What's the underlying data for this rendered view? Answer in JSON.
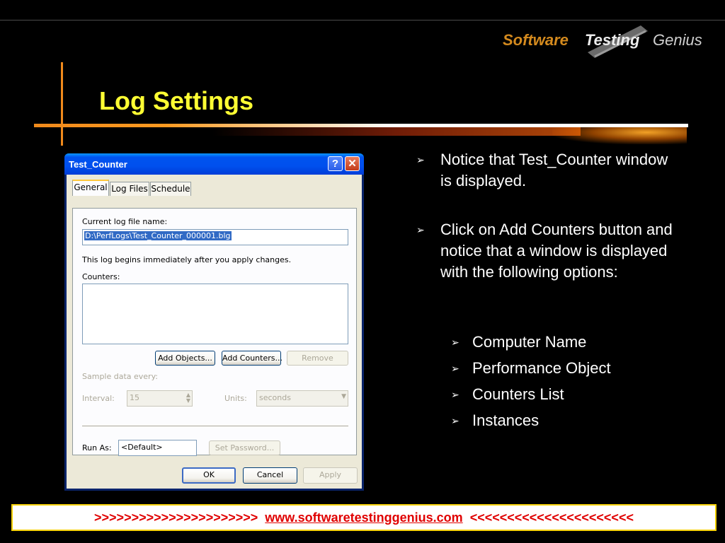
{
  "slide": {
    "logo": {
      "word1": "Software",
      "word2": "Testing",
      "word3": "Genius"
    },
    "title": "Log Settings",
    "bullets": [
      "Notice that Test_Counter window is displayed.",
      "Click on Add Counters button and notice that a window is displayed with the following options:"
    ],
    "sub_bullets": [
      "Computer Name",
      "Performance Object",
      "Counters List",
      "Instances"
    ],
    "footer": {
      "left": ">>>>>>>>>>>>>>>>>>>>>>",
      "link": "www.softwaretestinggenius.com",
      "right": "<<<<<<<<<<<<<<<<<<<<<<"
    }
  },
  "dialog": {
    "title": "Test_Counter",
    "help_glyph": "?",
    "close_glyph": "✕",
    "tabs": [
      "General",
      "Log Files",
      "Schedule"
    ],
    "current_log_label": "Current log file name:",
    "current_log_value": "D:\\PerfLogs\\Test_Counter_000001.blg",
    "info_text": "This log begins immediately after you apply changes.",
    "counters_label": "Counters:",
    "add_objects_label": "Add Objects...",
    "add_counters_label": "Add Counters...",
    "remove_label": "Remove",
    "sample_label": "Sample data every:",
    "interval_label": "Interval:",
    "interval_value": "15",
    "units_label": "Units:",
    "units_value": "seconds",
    "run_as_label": "Run As:",
    "run_as_value": "<Default>",
    "set_password_label": "Set Password...",
    "ok_label": "OK",
    "cancel_label": "Cancel",
    "apply_label": "Apply"
  },
  "colors": {
    "title": "#ffff33",
    "accent_orange": "#f08a1c",
    "footer_text": "#e00000",
    "xp_titlebar": "#0053ee"
  }
}
